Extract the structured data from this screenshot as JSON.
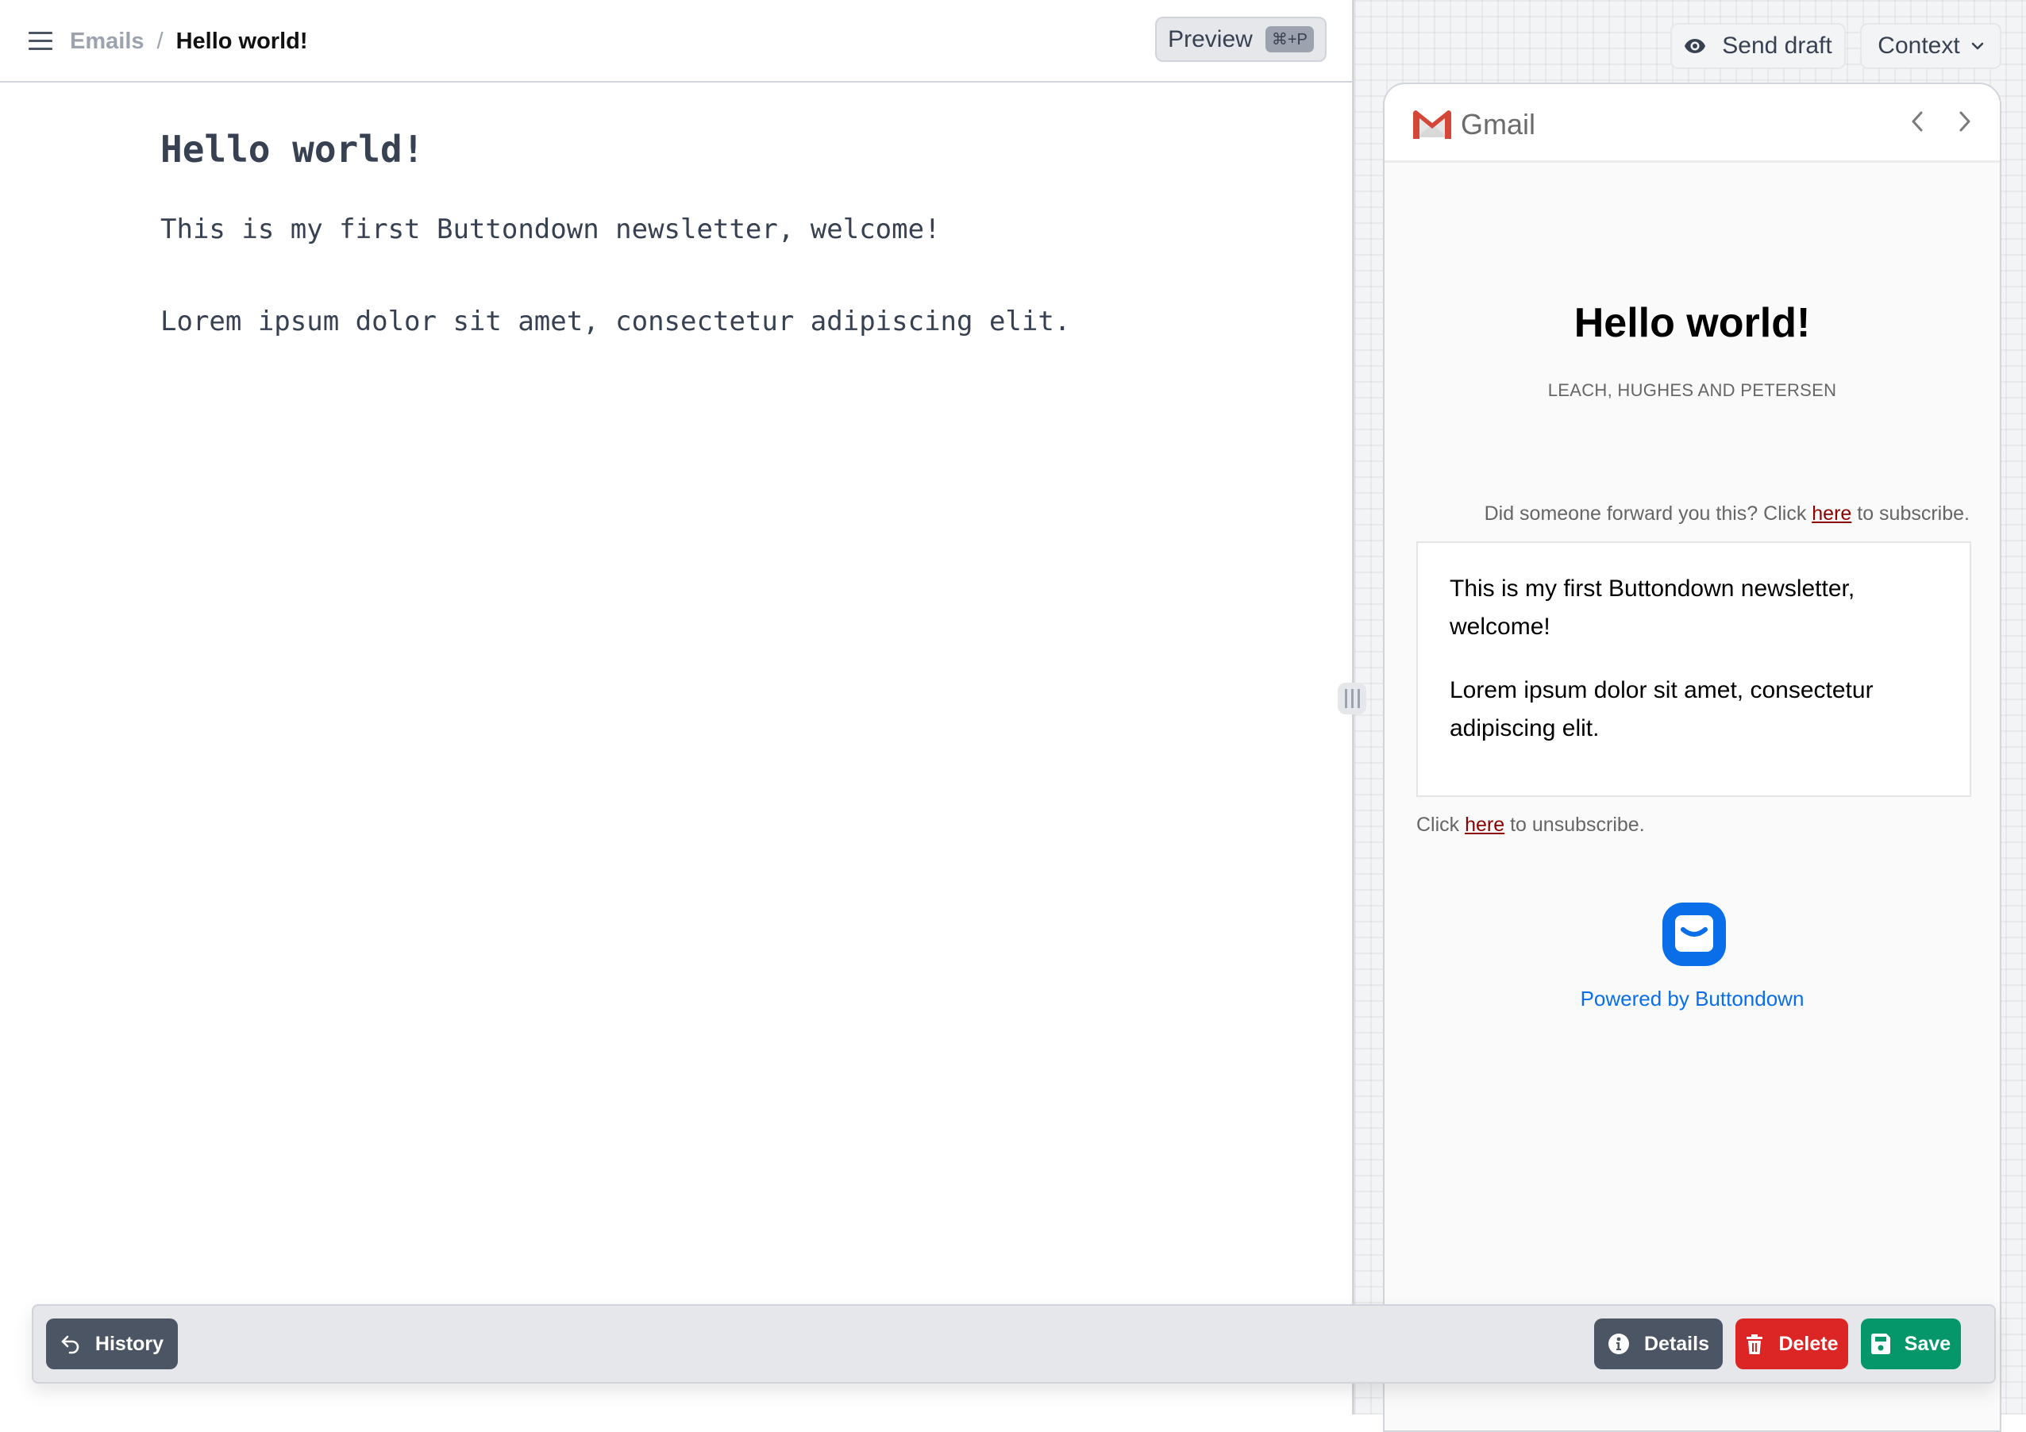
{
  "header": {
    "breadcrumb": {
      "root": "Emails",
      "separator": "/",
      "current": "Hello world!"
    },
    "preview_button": {
      "label": "Preview",
      "shortcut": "⌘+P"
    }
  },
  "editor": {
    "title": "Hello world!",
    "paragraphs": [
      "This is my first Buttondown newsletter, welcome!",
      "Lorem ipsum dolor sit amet, consectetur adipiscing elit."
    ]
  },
  "preview_panel": {
    "send_draft_label": "Send draft",
    "context_label": "Context",
    "client": {
      "name": "Gmail"
    },
    "email": {
      "title": "Hello world!",
      "sender": "LEACH, HUGHES AND PETERSEN",
      "forward_prefix": "Did someone forward you this? Click ",
      "forward_link": "here",
      "forward_suffix": " to subscribe.",
      "body": [
        "This is my first Buttondown newsletter, welcome!",
        "Lorem ipsum dolor sit amet, consectetur adipiscing elit."
      ],
      "unsub_prefix": "Click ",
      "unsub_link": "here",
      "unsub_suffix": " to unsubscribe.",
      "powered_by": "Powered by Buttondown"
    }
  },
  "toolbar": {
    "history_label": "History",
    "details_label": "Details",
    "delete_label": "Delete",
    "save_label": "Save"
  },
  "colors": {
    "brand_blue": "#0a6ee8",
    "delete": "#dc2626",
    "save": "#059669",
    "neutral_button": "#4b5563",
    "link": "#8b0000"
  }
}
